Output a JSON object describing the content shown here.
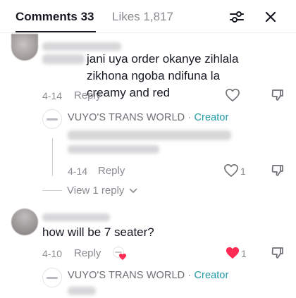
{
  "header": {
    "comments_label": "Comments 33",
    "likes_label": "Likes 1,817"
  },
  "comments": [
    {
      "text": "jani uya order okanye zihlala zikhona ngoba ndifuna la creamy and red",
      "date": "4-14",
      "reply_label": "Reply",
      "reply": {
        "author": "VUYO'S TRANS WORLD",
        "separator": "·",
        "badge": "Creator",
        "date": "4-14",
        "reply_label": "Reply",
        "like_count": "1"
      },
      "view_replies": "View 1 reply"
    },
    {
      "text": "how will be 7 seater?",
      "date": "4-10",
      "reply_label": "Reply",
      "like_count": "1",
      "reply": {
        "author": "VUYO'S TRANS WORLD",
        "separator": "·",
        "badge": "Creator"
      }
    }
  ],
  "colors": {
    "creator_badge": "#1f9aa6",
    "liked_heart": "#fe2c55",
    "muted_text": "#8a8b91"
  }
}
